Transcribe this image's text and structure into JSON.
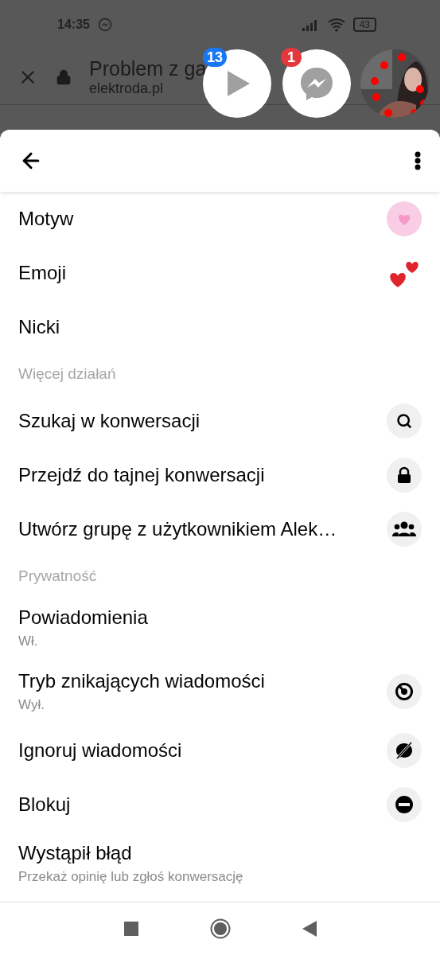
{
  "status_bar": {
    "time": "14:35",
    "battery": "43"
  },
  "browser": {
    "title": "Problem z ga",
    "domain": "elektroda.pl"
  },
  "chat_heads": [
    {
      "kind": "video",
      "badge": "13"
    },
    {
      "kind": "messenger",
      "badge": "1"
    },
    {
      "kind": "avatar"
    }
  ],
  "menu": [
    {
      "kind": "theme",
      "label": "Motyw"
    },
    {
      "kind": "emoji",
      "label": "Emoji"
    },
    {
      "kind": "plain",
      "label": "Nicki"
    },
    {
      "kind": "section",
      "label": "Więcej działań"
    },
    {
      "kind": "search",
      "label": "Szukaj w konwersacji"
    },
    {
      "kind": "lock",
      "label": "Przejdź do tajnej konwersacji"
    },
    {
      "kind": "group",
      "label": "Utwórz grupę z użytkownikiem Alek…"
    },
    {
      "kind": "section",
      "label": "Prywatność"
    },
    {
      "kind": "plain",
      "label": "Powiadomienia",
      "sublabel": "Wł."
    },
    {
      "kind": "timer",
      "label": "Tryb znikających wiadomości",
      "sublabel": "Wył."
    },
    {
      "kind": "ignore",
      "label": "Ignoruj wiadomości"
    },
    {
      "kind": "block",
      "label": "Blokuj"
    },
    {
      "kind": "plain",
      "label": "Wystąpił błąd",
      "sublabel": "Przekaż opinię lub zgłoś konwersację"
    }
  ]
}
